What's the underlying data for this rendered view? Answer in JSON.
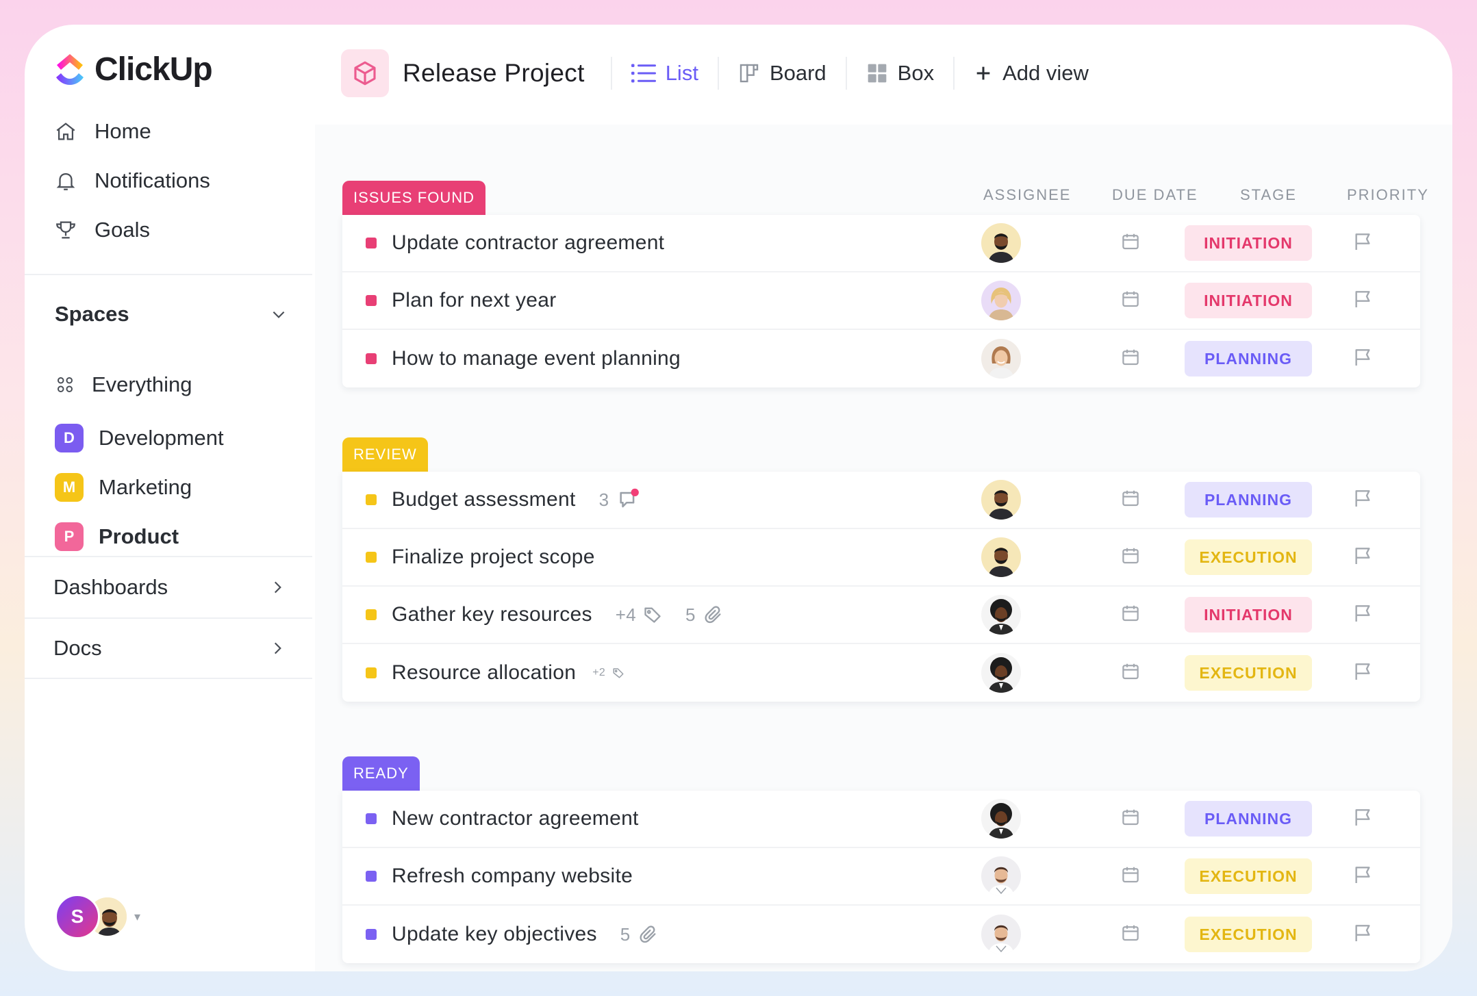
{
  "app": {
    "logo_text": "ClickUp"
  },
  "sidebar": {
    "nav": [
      {
        "label": "Home",
        "icon": "home-icon"
      },
      {
        "label": "Notifications",
        "icon": "bell-icon"
      },
      {
        "label": "Goals",
        "icon": "trophy-icon"
      }
    ],
    "spaces_label": "Spaces",
    "everything_label": "Everything",
    "spaces": [
      {
        "letter": "D",
        "label": "Development",
        "color": "#7b5cf0"
      },
      {
        "letter": "M",
        "label": "Marketing",
        "color": "#f5c518"
      },
      {
        "letter": "P",
        "label": "Product",
        "color": "#f2679a"
      }
    ],
    "dashboards_label": "Dashboards",
    "docs_label": "Docs",
    "user_initial": "S"
  },
  "header": {
    "project_title": "Release Project",
    "views": [
      {
        "label": "List",
        "icon": "list-icon",
        "active": true
      },
      {
        "label": "Board",
        "icon": "board-icon",
        "active": false
      },
      {
        "label": "Box",
        "icon": "box-icon",
        "active": false
      }
    ],
    "add_view_label": "Add view"
  },
  "columns": {
    "assignee": "ASSIGNEE",
    "due_date": "DUE DATE",
    "stage": "STAGE",
    "priority": "PRIORITY"
  },
  "groups": [
    {
      "label": "ISSUES FOUND",
      "color": "#e83f75",
      "tasks": [
        {
          "name": "Update contractor agreement",
          "stage": "INITIATION",
          "avatar": "man-beard"
        },
        {
          "name": "Plan for next year",
          "stage": "INITIATION",
          "avatar": "woman-blonde"
        },
        {
          "name": "How to manage event planning",
          "stage": "PLANNING",
          "avatar": "woman-smile"
        }
      ]
    },
    {
      "label": "REVIEW",
      "color": "#f5c518",
      "tasks": [
        {
          "name": "Budget assessment",
          "comments": "3",
          "stage": "PLANNING",
          "avatar": "man-beard"
        },
        {
          "name": "Finalize project scope",
          "stage": "EXECUTION",
          "avatar": "man-beard"
        },
        {
          "name": "Gather key resources",
          "tags": "+4",
          "attachments": "5",
          "stage": "INITIATION",
          "avatar": "man-afro"
        },
        {
          "name": "Resource allocation",
          "tags": "+2",
          "stage": "EXECUTION",
          "avatar": "man-afro"
        }
      ]
    },
    {
      "label": "READY",
      "color": "#7b61f2",
      "tasks": [
        {
          "name": "New contractor agreement",
          "stage": "PLANNING",
          "avatar": "man-afro"
        },
        {
          "name": "Refresh company website",
          "stage": "EXECUTION",
          "avatar": "man-short"
        },
        {
          "name": "Update key objectives",
          "attachments": "5",
          "stage": "EXECUTION",
          "avatar": "man-short"
        }
      ]
    }
  ]
}
